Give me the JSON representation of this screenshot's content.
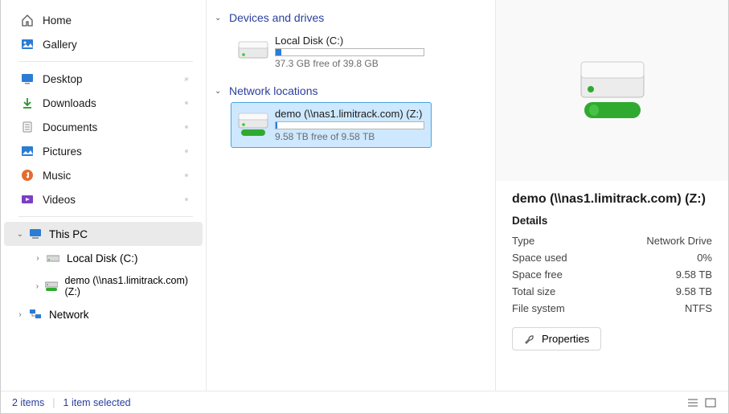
{
  "sidebar": {
    "home": "Home",
    "gallery": "Gallery",
    "desktop": "Desktop",
    "downloads": "Downloads",
    "documents": "Documents",
    "pictures": "Pictures",
    "music": "Music",
    "videos": "Videos",
    "thispc": "This PC",
    "localdisk": "Local Disk (C:)",
    "netdrive": "demo (\\\\nas1.limitrack.com) (Z:)",
    "network": "Network"
  },
  "main": {
    "devices_header": "Devices and drives",
    "network_header": "Network locations",
    "local": {
      "name": "Local Disk (C:)",
      "status": "37.3 GB free of 39.8 GB"
    },
    "net": {
      "name": "demo (\\\\nas1.limitrack.com) (Z:)",
      "status": "9.58 TB free of 9.58 TB"
    }
  },
  "details": {
    "title": "demo (\\\\nas1.limitrack.com) (Z:)",
    "heading": "Details",
    "type_k": "Type",
    "type_v": "Network Drive",
    "used_k": "Space used",
    "used_v": "0%",
    "free_k": "Space free",
    "free_v": "9.58 TB",
    "total_k": "Total size",
    "total_v": "9.58 TB",
    "fs_k": "File system",
    "fs_v": "NTFS",
    "properties": "Properties"
  },
  "status": {
    "items": "2 items",
    "selected": "1 item selected"
  }
}
